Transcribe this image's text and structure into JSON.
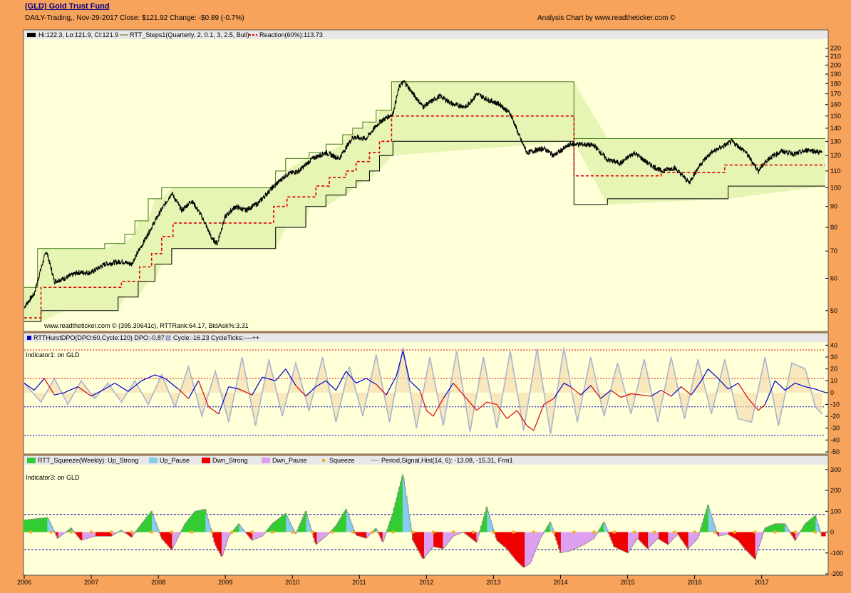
{
  "header": {
    "title": "(GLD) Gold Trust Fund",
    "subtitle": "DAILY-Trading,, Nov-29-2017  Close: $121.92  Change: -$0.89  (-0.7%)",
    "credit": "Analysis Chart by www.readtheticker.com ©"
  },
  "colors": {
    "background": "#F7A35B",
    "panel": "#FFFFD8",
    "legend_bar": "#E8E8E8",
    "price": "#000000",
    "step_box": "#3A7A10",
    "step_fill": "#DDF0A8",
    "reaction": "#E00000",
    "dpo_up": "#0000CC",
    "dpo_down": "#DD0000",
    "cycle": "#A8B4D0",
    "up_strong": "#33CC33",
    "up_pause": "#88CCEE",
    "dwn_strong": "#EE0000",
    "dwn_pause": "#DDA0EE",
    "squeeze": "#F0B020"
  },
  "panels": [
    {
      "id": "price",
      "legend": [
        "Hi:122.3, Lo:121.9, Cl:121.9",
        "RTT_Steps1(Quarterly, 2, 0.1, 3, 2.5, Bull)",
        "Reaction(60%):113.73"
      ],
      "footer": "www.readtheticker.com © (395.30641c), RTTRank:64.17, BidAsk%:3.31",
      "ticks": [
        "220",
        "210",
        "200",
        "190",
        "180",
        "170",
        "160",
        "150",
        "140",
        "130",
        "120",
        "110",
        "100",
        "90",
        "80",
        "70",
        "60",
        "50"
      ]
    },
    {
      "id": "dpo",
      "legend": [
        "RTTHurstDPO(DPO:60,Cycle:120) DPO:-0.87",
        "Cycle:-16.23 CycleTicks:----++"
      ],
      "label": "Indicator1: on GLD",
      "ticks": [
        "40",
        "30",
        "20",
        "10",
        "0",
        "-10",
        "-20",
        "-30",
        "-40",
        "-50"
      ]
    },
    {
      "id": "squeeze",
      "legend": [
        "RTT_Squeeze(Weekly): Up_Strong",
        "Up_Pause",
        "Dwn_Strong",
        "Dwn_Pause",
        "Squeeze",
        "Period,Signal,Hist(14, 6): -13.08, -15.31, Frm1"
      ],
      "label": "Indicator3: on GLD",
      "ticks": [
        "300",
        "200",
        "100",
        "0",
        "-100",
        "-200"
      ]
    }
  ],
  "x_axis": [
    "2006",
    "2007",
    "2008",
    "2009",
    "2010",
    "2011",
    "2012",
    "2013",
    "2014",
    "2015",
    "2016",
    "2017"
  ],
  "chart_data": [
    {
      "type": "line",
      "title": "(GLD) Gold Trust Fund",
      "xlabel": "",
      "ylabel": "",
      "scale": "log",
      "ylim": [
        45,
        225
      ],
      "x_range": [
        2006.0,
        2017.95
      ],
      "series": [
        {
          "name": "GLD",
          "x": [
            2006.0,
            2006.15,
            2006.33,
            2006.45,
            2006.6,
            2006.8,
            2007.0,
            2007.2,
            2007.45,
            2007.6,
            2007.75,
            2007.9,
            2008.2,
            2008.35,
            2008.5,
            2008.65,
            2008.8,
            2008.88,
            2009.0,
            2009.15,
            2009.3,
            2009.5,
            2009.7,
            2009.92,
            2010.1,
            2010.3,
            2010.5,
            2010.7,
            2010.9,
            2011.1,
            2011.3,
            2011.5,
            2011.6,
            2011.67,
            2011.8,
            2011.95,
            2012.2,
            2012.4,
            2012.6,
            2012.75,
            2012.9,
            2013.1,
            2013.25,
            2013.4,
            2013.5,
            2013.75,
            2013.9,
            2014.15,
            2014.3,
            2014.5,
            2014.7,
            2014.9,
            2015.1,
            2015.3,
            2015.5,
            2015.7,
            2015.92,
            2016.1,
            2016.25,
            2016.45,
            2016.55,
            2016.75,
            2016.95,
            2017.1,
            2017.3,
            2017.5,
            2017.7,
            2017.9
          ],
          "values": [
            51,
            55,
            70,
            59,
            60,
            62,
            62,
            65,
            66,
            65,
            72,
            80,
            97,
            88,
            93,
            85,
            75,
            73,
            85,
            90,
            88,
            92,
            100,
            108,
            110,
            118,
            122,
            118,
            133,
            132,
            145,
            152,
            178,
            182,
            170,
            158,
            168,
            160,
            158,
            170,
            165,
            160,
            152,
            132,
            122,
            125,
            120,
            128,
            128,
            127,
            117,
            115,
            122,
            115,
            110,
            112,
            103,
            115,
            122,
            127,
            130,
            123,
            110,
            118,
            123,
            121,
            124,
            121.9
          ]
        },
        {
          "name": "RTT_Steps1 upper",
          "x": [
            2006.0,
            2006.2,
            2006.2,
            2006.6,
            2006.6,
            2007.2,
            2007.2,
            2007.5,
            2007.5,
            2007.65,
            2007.65,
            2007.85,
            2007.85,
            2008.05,
            2008.05,
            2008.22,
            2008.22,
            2009.75,
            2009.75,
            2009.9,
            2009.9,
            2010.25,
            2010.25,
            2010.5,
            2010.5,
            2010.75,
            2010.75,
            2010.9,
            2010.9,
            2011.05,
            2011.05,
            2011.25,
            2011.25,
            2011.48,
            2011.48,
            2014.2,
            2014.2,
            2017.95
          ],
          "values": [
            57,
            57,
            71,
            71,
            71,
            71,
            73,
            73,
            77,
            77,
            83,
            83,
            94,
            94,
            100,
            100,
            100,
            100,
            110,
            110,
            118,
            118,
            122,
            122,
            128,
            128,
            135,
            135,
            140,
            140,
            145,
            145,
            155,
            155,
            182,
            182,
            132,
            132
          ]
        },
        {
          "name": "RTT_Steps1 lower",
          "x": [
            2006.0,
            2006.25,
            2006.25,
            2007.4,
            2007.4,
            2007.7,
            2007.7,
            2007.95,
            2007.95,
            2008.2,
            2008.2,
            2009.75,
            2009.75,
            2010.2,
            2010.2,
            2010.5,
            2010.5,
            2010.8,
            2010.8,
            2010.95,
            2010.95,
            2011.15,
            2011.15,
            2011.3,
            2011.3,
            2011.5,
            2011.5,
            2014.2,
            2014.2,
            2014.7,
            2014.7,
            2016.5,
            2016.5,
            2017.95
          ],
          "values": [
            47,
            47,
            50,
            50,
            54,
            54,
            59,
            59,
            65,
            65,
            71,
            71,
            80,
            80,
            90,
            90,
            96,
            96,
            100,
            100,
            104,
            104,
            110,
            110,
            120,
            120,
            130,
            130,
            91,
            91,
            94,
            94,
            101,
            101
          ]
        },
        {
          "name": "Reaction(60%)",
          "x": [
            2006.0,
            2006.25,
            2006.25,
            2007.45,
            2007.45,
            2007.72,
            2007.72,
            2007.9,
            2007.9,
            2008.05,
            2008.05,
            2008.22,
            2008.22,
            2009.72,
            2009.72,
            2009.92,
            2009.92,
            2010.35,
            2010.35,
            2010.55,
            2010.55,
            2010.8,
            2010.8,
            2010.95,
            2010.95,
            2011.15,
            2011.15,
            2011.3,
            2011.3,
            2011.48,
            2011.48,
            2014.2,
            2014.2,
            2015.5,
            2015.5,
            2016.45,
            2016.45,
            2017.95
          ],
          "values": [
            48,
            48,
            57,
            57,
            59,
            59,
            64,
            64,
            69,
            69,
            76,
            76,
            82,
            82,
            90,
            90,
            95,
            95,
            101,
            101,
            106,
            106,
            110,
            110,
            116,
            116,
            122,
            122,
            130,
            130,
            150,
            150,
            107,
            107,
            109,
            109,
            113.73,
            113.73
          ]
        }
      ]
    },
    {
      "type": "line",
      "title": "RTTHurstDPO(DPO:60,Cycle:120)",
      "xlabel": "",
      "ylabel": "",
      "ylim": [
        -50,
        42
      ],
      "reference_lines": [
        36,
        12,
        -12,
        -36
      ],
      "series": [
        {
          "name": "RTTHurstDPO(DPO:60,Cycle:120) DPO:-0.87",
          "x": [
            2006.0,
            2006.15,
            2006.3,
            2006.45,
            2006.6,
            2006.8,
            2007.0,
            2007.2,
            2007.35,
            2007.55,
            2007.75,
            2007.95,
            2008.1,
            2008.3,
            2008.45,
            2008.6,
            2008.75,
            2008.9,
            2009.05,
            2009.2,
            2009.4,
            2009.55,
            2009.75,
            2009.9,
            2010.05,
            2010.2,
            2010.35,
            2010.5,
            2010.65,
            2010.8,
            2010.95,
            2011.1,
            2011.25,
            2011.4,
            2011.55,
            2011.65,
            2011.75,
            2011.9,
            2012.0,
            2012.1,
            2012.25,
            2012.4,
            2012.55,
            2012.75,
            2012.9,
            2013.05,
            2013.2,
            2013.35,
            2013.5,
            2013.6,
            2013.75,
            2013.9,
            2014.05,
            2014.15,
            2014.3,
            2014.45,
            2014.6,
            2014.75,
            2014.9,
            2015.05,
            2015.2,
            2015.35,
            2015.5,
            2015.65,
            2015.8,
            2015.95,
            2016.1,
            2016.2,
            2016.35,
            2016.5,
            2016.65,
            2016.8,
            2016.95,
            2017.05,
            2017.2,
            2017.35,
            2017.5,
            2017.65,
            2017.8,
            2017.95
          ],
          "values": [
            8,
            2,
            12,
            -2,
            0,
            5,
            -3,
            3,
            8,
            1,
            10,
            15,
            12,
            3,
            -5,
            10,
            -12,
            -18,
            5,
            3,
            -2,
            13,
            10,
            20,
            6,
            -3,
            5,
            10,
            2,
            18,
            8,
            12,
            7,
            -2,
            14,
            35,
            10,
            2,
            -15,
            -20,
            -5,
            8,
            -2,
            -15,
            -8,
            -10,
            -22,
            -15,
            -28,
            -32,
            -10,
            -5,
            8,
            5,
            -2,
            6,
            -5,
            2,
            -4,
            -1,
            -2,
            -3,
            2,
            -3,
            5,
            -2,
            10,
            20,
            12,
            3,
            8,
            -5,
            -15,
            -10,
            10,
            2,
            8,
            5,
            3,
            0
          ]
        },
        {
          "name": "Cycle:-16.23 CycleTicks:----++",
          "x": [
            2006.0,
            2006.25,
            2006.45,
            2006.65,
            2006.85,
            2007.05,
            2007.25,
            2007.45,
            2007.65,
            2007.85,
            2008.05,
            2008.25,
            2008.45,
            2008.65,
            2008.85,
            2009.05,
            2009.25,
            2009.45,
            2009.65,
            2009.85,
            2010.05,
            2010.25,
            2010.45,
            2010.65,
            2010.85,
            2011.05,
            2011.25,
            2011.45,
            2011.65,
            2011.85,
            2012.05,
            2012.25,
            2012.45,
            2012.65,
            2012.85,
            2013.05,
            2013.25,
            2013.45,
            2013.65,
            2013.85,
            2014.05,
            2014.25,
            2014.45,
            2014.65,
            2014.85,
            2015.05,
            2015.25,
            2015.45,
            2015.65,
            2015.85,
            2016.05,
            2016.25,
            2016.45,
            2016.65,
            2016.85,
            2017.05,
            2017.25,
            2017.45,
            2017.65,
            2017.8,
            2017.9
          ],
          "values": [
            8,
            -8,
            12,
            -10,
            10,
            -5,
            8,
            -8,
            10,
            -10,
            15,
            -12,
            22,
            -20,
            18,
            -25,
            30,
            -28,
            28,
            -20,
            25,
            -15,
            30,
            -25,
            22,
            -20,
            32,
            -25,
            38,
            -30,
            30,
            -28,
            35,
            -33,
            30,
            -30,
            35,
            -32,
            37,
            -35,
            38,
            -25,
            30,
            -20,
            25,
            -18,
            28,
            -25,
            30,
            -22,
            28,
            -18,
            28,
            -22,
            -25,
            30,
            -28,
            25,
            20,
            -12,
            -18
          ]
        }
      ]
    },
    {
      "type": "bar",
      "title": "RTT_Squeeze(Weekly)",
      "xlabel": "",
      "ylabel": "",
      "ylim": [
        -200,
        320
      ],
      "reference_lines": [
        85,
        -85
      ],
      "series": [
        {
          "name": "Hist",
          "x": [
            2006.05,
            2006.35,
            2006.5,
            2006.7,
            2006.85,
            2007.05,
            2007.3,
            2007.45,
            2007.6,
            2007.8,
            2007.9,
            2008.05,
            2008.2,
            2008.4,
            2008.55,
            2008.7,
            2008.85,
            2008.95,
            2009.05,
            2009.2,
            2009.4,
            2009.55,
            2009.7,
            2009.9,
            2010.05,
            2010.2,
            2010.35,
            2010.5,
            2010.65,
            2010.8,
            2010.95,
            2011.1,
            2011.25,
            2011.35,
            2011.5,
            2011.65,
            2011.8,
            2011.95,
            2012.1,
            2012.25,
            2012.4,
            2012.55,
            2012.75,
            2012.9,
            2013.05,
            2013.2,
            2013.35,
            2013.45,
            2013.55,
            2013.7,
            2013.85,
            2014.0,
            2014.15,
            2014.35,
            2014.5,
            2014.65,
            2014.8,
            2015.0,
            2015.15,
            2015.3,
            2015.45,
            2015.6,
            2015.75,
            2015.9,
            2016.05,
            2016.2,
            2016.35,
            2016.5,
            2016.65,
            2016.75,
            2016.9,
            2017.05,
            2017.2,
            2017.35,
            2017.5,
            2017.65,
            2017.8,
            2017.9
          ],
          "values": [
            60,
            70,
            -30,
            20,
            -40,
            -20,
            -20,
            10,
            -25,
            60,
            100,
            -30,
            -85,
            40,
            100,
            110,
            -60,
            -120,
            -20,
            40,
            -40,
            -20,
            40,
            90,
            -10,
            100,
            -60,
            -20,
            30,
            110,
            -15,
            -30,
            20,
            -50,
            90,
            280,
            -40,
            -130,
            -70,
            -80,
            -20,
            0,
            -50,
            120,
            -40,
            -80,
            -140,
            -170,
            -150,
            -30,
            50,
            -100,
            -90,
            -60,
            -30,
            50,
            -70,
            -100,
            -30,
            -80,
            -30,
            -60,
            -10,
            -80,
            -30,
            130,
            -20,
            -10,
            -40,
            -80,
            -130,
            20,
            40,
            40,
            -40,
            40,
            80,
            -20
          ]
        }
      ]
    }
  ]
}
